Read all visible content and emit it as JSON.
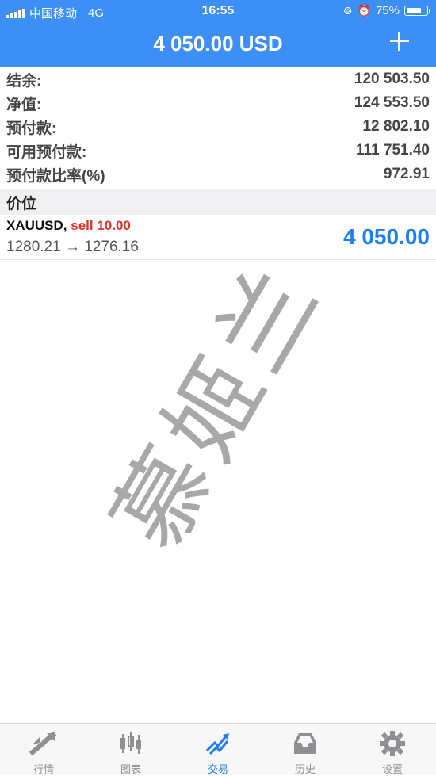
{
  "status_bar": {
    "carrier": "中国移动",
    "network": "4G",
    "time": "16:55",
    "battery": "75%"
  },
  "header": {
    "title": "4 050.00 USD",
    "add_icon": "plus-icon"
  },
  "summary": [
    {
      "label": "结余:",
      "value": "120 503.50"
    },
    {
      "label": "净值:",
      "value": "124 553.50"
    },
    {
      "label": "预付款:",
      "value": "12 802.10"
    },
    {
      "label": "可用预付款:",
      "value": "111 751.40"
    },
    {
      "label": "预付款比率(%)",
      "value": "972.91"
    }
  ],
  "section": {
    "label": "价位"
  },
  "position": {
    "symbol": "XAUUSD",
    "separator": ",",
    "side": "sell 10.00",
    "open_price": "1280.21",
    "arrow": "→",
    "current_price": "1276.16",
    "profit": "4 050.00"
  },
  "watermark": "慕姬兰",
  "tabs": [
    {
      "label": "行情",
      "icon": "quotes-icon",
      "active": false
    },
    {
      "label": "图表",
      "icon": "chart-icon",
      "active": false
    },
    {
      "label": "交易",
      "icon": "trade-icon",
      "active": true
    },
    {
      "label": "历史",
      "icon": "history-icon",
      "active": false
    },
    {
      "label": "设置",
      "icon": "settings-icon",
      "active": false
    }
  ],
  "colors": {
    "header_bg": "#3d8ff5",
    "sell": "#e4322b",
    "profit": "#1f7ef0",
    "tab_active": "#1f7ef0",
    "tab_inactive": "#8e8e93"
  }
}
